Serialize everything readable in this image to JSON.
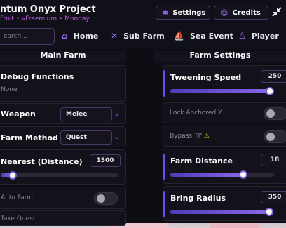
{
  "app": {
    "title": "ntum Onyx Project",
    "subtitle": "Fruit • vFreemium • Monday"
  },
  "topbar": {
    "settings_label": "Settings",
    "credits_label": "Credits"
  },
  "search": {
    "placeholder": "earch..."
  },
  "tabs": [
    {
      "label": "Home",
      "icon": "home-icon"
    },
    {
      "label": "Sub Farm",
      "icon": "swords-icon"
    },
    {
      "label": "Sea Event",
      "icon": "boat-icon"
    },
    {
      "label": "Player",
      "icon": "user-icon"
    }
  ],
  "left_column": {
    "header": "Main Farm",
    "debug": {
      "label": "Debug Functions",
      "value": "None"
    },
    "weapon": {
      "label": "Weapon",
      "selected": "Melee"
    },
    "farm_method": {
      "label": "Farm Method",
      "selected": "Quest"
    },
    "nearest": {
      "label": "Nearest (Distance)",
      "value": "1500",
      "fraction": 0.1
    },
    "auto_farm": {
      "label": "Auto Farm",
      "enabled": false
    },
    "take_quest": {
      "label": "Take Quest"
    }
  },
  "right_column": {
    "header": "Farm Settings",
    "tweening_speed": {
      "label": "Tweening Speed",
      "value": "250",
      "fraction": 0.97
    },
    "lock_anchored_y": {
      "label": "Lock Anchored Y",
      "enabled": false
    },
    "bypass_tp": {
      "label": "Bypass TP",
      "warning_icon": "warning-icon",
      "enabled": false
    },
    "farm_distance": {
      "label": "Farm Distance",
      "value": "18",
      "fraction": 0.7
    },
    "bring_radius": {
      "label": "Bring Radius",
      "value": "350",
      "fraction": 0.95
    }
  },
  "colors": {
    "accent": "#6b47ff",
    "accent_light": "#8a68e8",
    "subtitle": "#b55bd6",
    "panel": "#13111a",
    "border": "#4a3a6a"
  }
}
